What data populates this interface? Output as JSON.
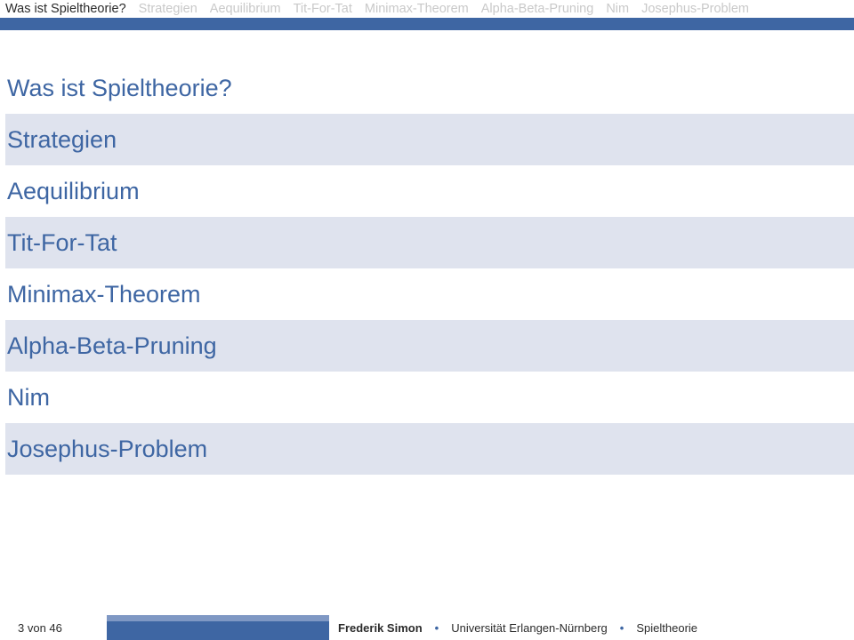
{
  "nav": {
    "items": [
      "Was ist Spieltheorie?",
      "Strategien",
      "Aequilibrium",
      "Tit-For-Tat",
      "Minimax-Theorem",
      "Alpha-Beta-Pruning",
      "Nim",
      "Josephus-Problem"
    ],
    "active_index": 0
  },
  "toc": {
    "items": [
      "Was ist Spieltheorie?",
      "Strategien",
      "Aequilibrium",
      "Tit-For-Tat",
      "Minimax-Theorem",
      "Alpha-Beta-Pruning",
      "Nim",
      "Josephus-Problem"
    ]
  },
  "footer": {
    "page": "3 von 46",
    "author": "Frederik Simon",
    "institution": "Universität Erlangen-Nürnberg",
    "title": "Spieltheorie",
    "bullet": "•"
  },
  "colors": {
    "accent": "#3e66a3",
    "accent_light": "#7f98c4",
    "stripe": "#dfe3ee",
    "inactive": "#c9c9c9"
  }
}
